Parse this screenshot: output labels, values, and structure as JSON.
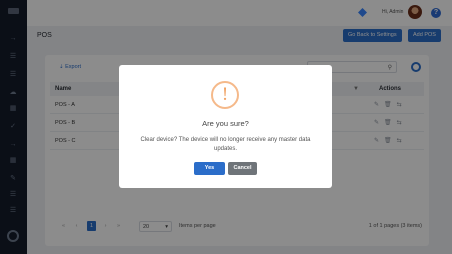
{
  "topbar": {
    "greeting": "Hi, Admin",
    "help_glyph": "?"
  },
  "page": {
    "title": "POS",
    "go_back_label": "Go Back to Settings",
    "add_label": "Add POS"
  },
  "toolbar": {
    "export_label": "Export"
  },
  "table": {
    "headers": {
      "name": "Name",
      "actions": "Actions"
    },
    "rows": [
      {
        "name": "POS - A"
      },
      {
        "name": "POS - B"
      },
      {
        "name": "POS - C"
      }
    ]
  },
  "pagination": {
    "current_page": "1",
    "page_size": "20",
    "items_per_page_label": "Items per page",
    "range_text": "1 of 1 pages (3 items)"
  },
  "modal": {
    "icon_glyph": "!",
    "title": "Are you sure?",
    "message": "Clear device? The device will no longer receive any master data updates.",
    "yes_label": "Yes",
    "cancel_label": "Cancel"
  },
  "colors": {
    "primary": "#2b6dc9",
    "sidebar": "#141d2b",
    "warning": "#f5b98a",
    "cancel": "#6f7479"
  },
  "icons": [
    "logo-icon",
    "diamond-icon",
    "avatar",
    "help-icon",
    "export-icon",
    "search-icon",
    "settings-icon",
    "filter-icon",
    "edit-icon",
    "delete-icon",
    "link-icon",
    "warning-icon"
  ]
}
